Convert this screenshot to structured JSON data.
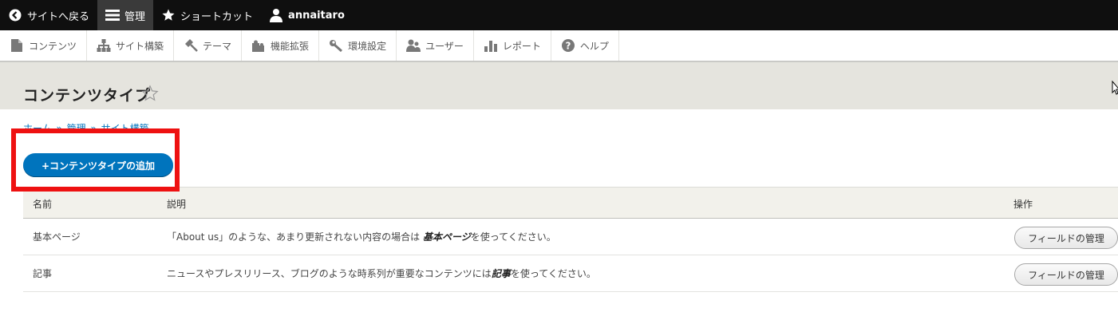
{
  "toolbar": {
    "back": "サイトへ戻る",
    "manage": "管理",
    "shortcuts": "ショートカット",
    "user": "annaitaro"
  },
  "tray": {
    "items": [
      {
        "label": "コンテンツ",
        "icon": "file-icon"
      },
      {
        "label": "サイト構築",
        "icon": "sitemap-icon"
      },
      {
        "label": "テーマ",
        "icon": "paintbrush-icon"
      },
      {
        "label": "機能拡張",
        "icon": "puzzle-icon"
      },
      {
        "label": "環境設定",
        "icon": "wrench-icon"
      },
      {
        "label": "ユーザー",
        "icon": "people-icon"
      },
      {
        "label": "レポート",
        "icon": "bar-chart-icon"
      },
      {
        "label": "ヘルプ",
        "icon": "help-icon"
      }
    ]
  },
  "page": {
    "title": "コンテンツタイプ",
    "breadcrumb": [
      "ホーム",
      "»",
      "管理",
      "»",
      "サイト構築"
    ],
    "add_button": "+コンテンツタイプの追加"
  },
  "table": {
    "headers": {
      "name": "名前",
      "description": "説明",
      "operations": "操作"
    },
    "rows": [
      {
        "name": "基本ページ",
        "desc_pre": "「About us」のような、あまり更新されない内容の場合は ",
        "desc_em": "基本ページ",
        "desc_post": "を使ってください。",
        "action": "フィールドの管理"
      },
      {
        "name": "記事",
        "desc_pre": "ニュースやプレスリリース、ブログのような時系列が重要なコンテンツには",
        "desc_em": "記事",
        "desc_post": "を使ってください。",
        "action": "フィールドの管理"
      }
    ]
  },
  "colors": {
    "accent": "#0074bd",
    "highlight": "#ee1111",
    "toolbar_bg": "#0f0f0f"
  }
}
